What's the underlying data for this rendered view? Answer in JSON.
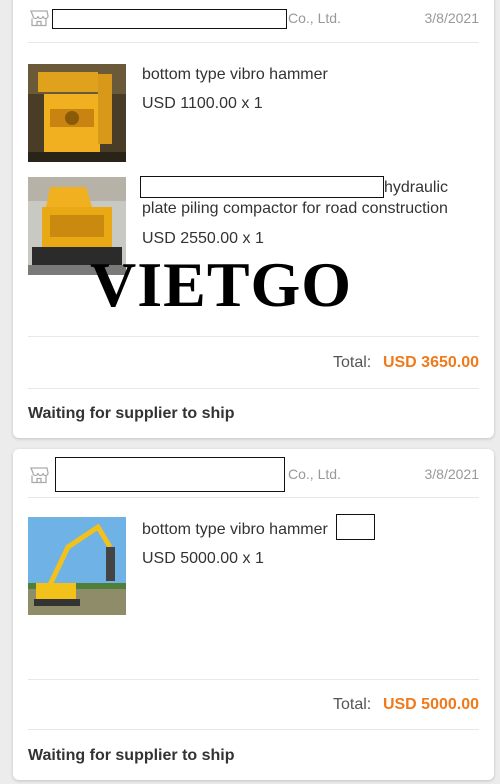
{
  "orders": [
    {
      "supplier_suffix": "Co., Ltd.",
      "date": "3/8/2021",
      "items": [
        {
          "title": "bottom type  vibro hammer",
          "price": "USD 1100.00 x 1"
        },
        {
          "title": "hydraulic",
          "title_line2": "plate piling compactor for road construction",
          "price": "USD 2550.00 x 1"
        }
      ],
      "total_label": "Total:",
      "total_value": "USD 3650.00",
      "status": "Waiting for supplier to ship"
    },
    {
      "supplier_suffix": "Co., Ltd.",
      "date": "3/8/2021",
      "items": [
        {
          "title": "bottom type vibro hammer",
          "price": "USD 5000.00 x 1"
        }
      ],
      "total_label": "Total:",
      "total_value": "USD 5000.00",
      "status": "Waiting for supplier to ship"
    }
  ],
  "watermark": "VIETGO",
  "colors": {
    "accent": "#f07a1a",
    "background": "#ececec"
  },
  "icons": {
    "store": "store-icon"
  }
}
